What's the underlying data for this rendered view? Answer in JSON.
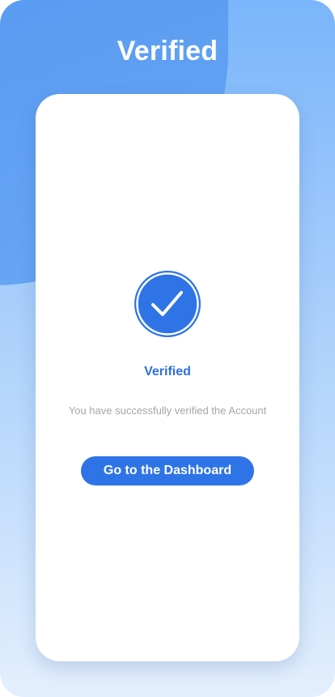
{
  "header": {
    "title": "Verified"
  },
  "card": {
    "icon": "check-circle-icon",
    "status_title": "Verified",
    "message": "You have successfully verified the Account",
    "button_label": "Go to the Dashboard"
  },
  "colors": {
    "primary": "#2f74e6",
    "status_text": "#2f6fde",
    "message_text": "#a6a6a6"
  }
}
